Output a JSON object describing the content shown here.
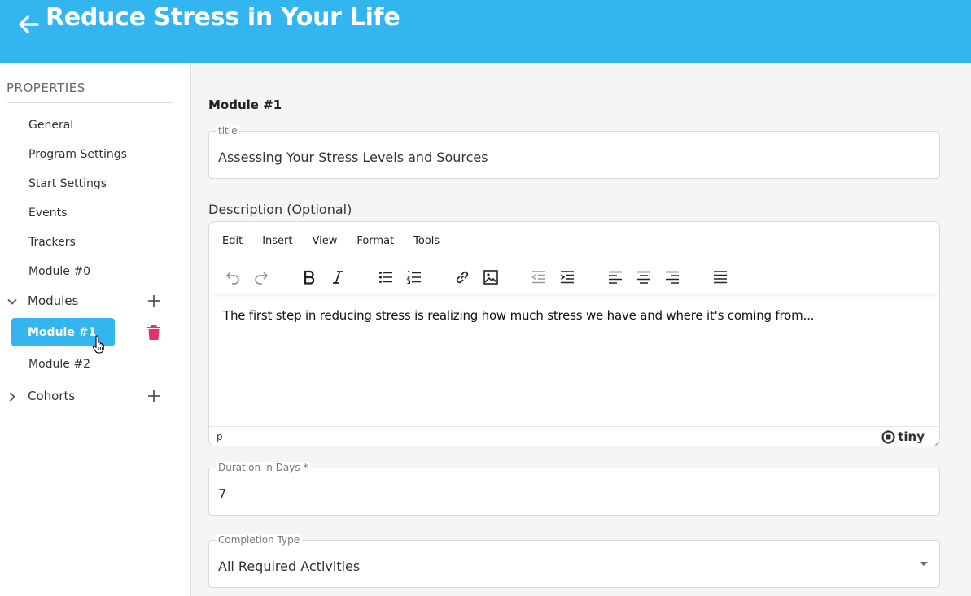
{
  "header": {
    "title": "Reduce Stress in Your Life",
    "back_icon": "arrow-left-icon"
  },
  "sidebar": {
    "heading": "PROPERTIES",
    "items": [
      "General",
      "Program Settings",
      "Start Settings",
      "Events",
      "Trackers",
      "Module #0"
    ],
    "modules_group": {
      "label": "Modules",
      "expanded": true
    },
    "modules": [
      "Module #1",
      "Module #2"
    ],
    "cohorts_group": {
      "label": "Cohorts",
      "expanded": false
    },
    "active_color": "#33b6f0",
    "delete_color": "#e8306e"
  },
  "main": {
    "section_title": "Module #1",
    "title_field": {
      "label": "title",
      "value": "Assessing Your Stress Levels and Sources"
    },
    "description_label": "Description (Optional)",
    "editor": {
      "menu": [
        "Edit",
        "Insert",
        "View",
        "Format",
        "Tools"
      ],
      "content": "The first step in reducing stress is realizing how much stress we have and where it's coming from...",
      "status_path": "p",
      "brand": "tiny"
    },
    "duration_field": {
      "label": "Duration in Days *",
      "value": "7"
    },
    "completion_field": {
      "label": "Completion Type",
      "value": "All Required Activities"
    }
  },
  "colors": {
    "header_bg": "#33b6f0",
    "page_bg": "#f5f5f5"
  }
}
